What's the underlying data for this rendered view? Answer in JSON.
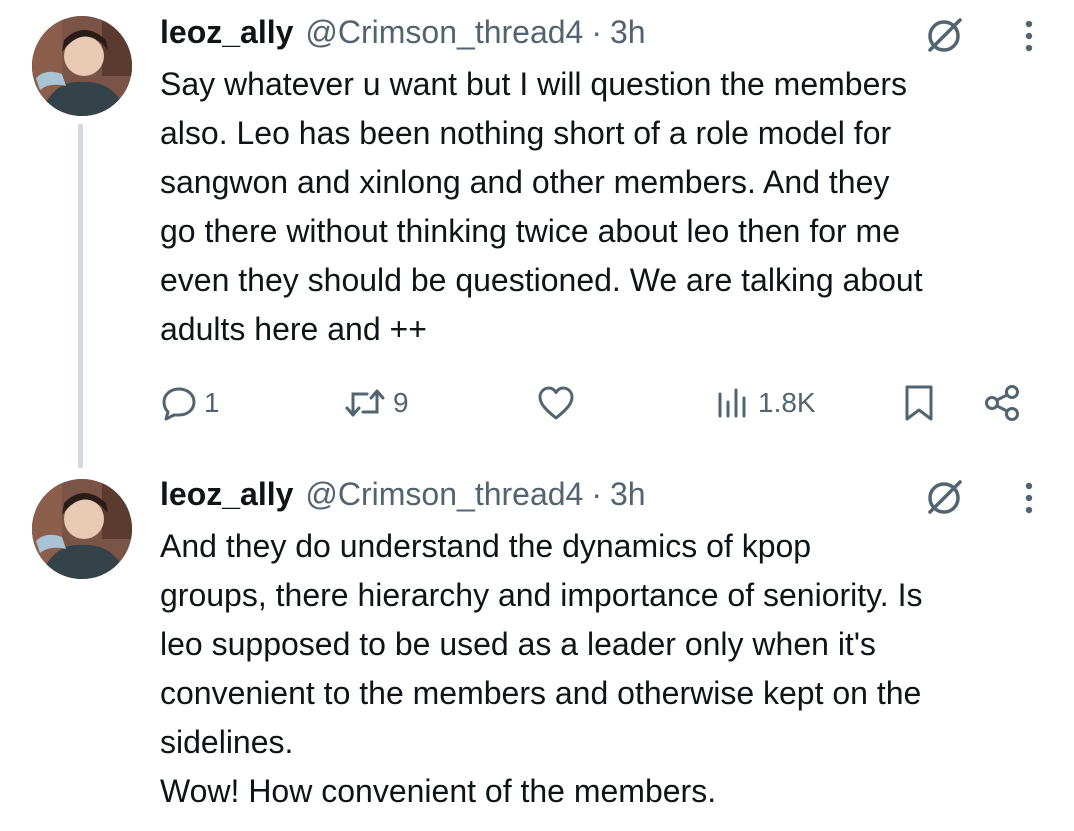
{
  "tweets": [
    {
      "author_name": "leoz_ally",
      "handle": "@Crimson_thread4",
      "separator": "·",
      "time": "3h",
      "text": "Say whatever u want but I will question the members\nalso. Leo has been nothing short of a role model for\nsangwon and xinlong and other members. And they\ngo there without thinking twice about leo then for me\neven they should be questioned. We are talking about\nadults here and ++",
      "replies": "1",
      "reposts": "9",
      "views": "1.8K"
    },
    {
      "author_name": "leoz_ally",
      "handle": "@Crimson_thread4",
      "separator": "·",
      "time": "3h",
      "text": "And they do understand the dynamics of kpop\ngroups, there hierarchy and importance of seniority. Is\nleo supposed to be used as a leader only when it's\nconvenient to the members and otherwise kept on the\nsidelines.\nWow! How convenient of the members."
    }
  ],
  "icons": {
    "grok": "grok-icon",
    "more": "more-icon",
    "reply": "reply-icon",
    "repost": "repost-icon",
    "like": "heart-icon",
    "views": "views-icon",
    "bookmark": "bookmark-icon",
    "share": "share-icon"
  },
  "colors": {
    "text": "#0f1419",
    "secondary": "#536471",
    "thread_line": "#cfd9de"
  }
}
